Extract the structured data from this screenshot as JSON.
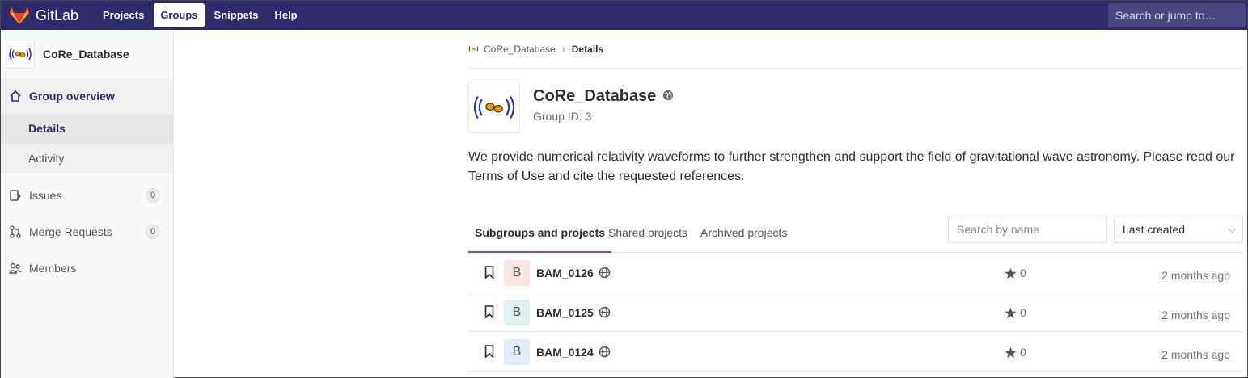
{
  "navbar": {
    "brand": "GitLab",
    "items": [
      {
        "label": "Projects",
        "active": false
      },
      {
        "label": "Groups",
        "active": true
      },
      {
        "label": "Snippets",
        "active": false
      },
      {
        "label": "Help",
        "active": false
      }
    ],
    "search_placeholder": "Search or jump to…"
  },
  "sidebar": {
    "context_title": "CoRe_Database",
    "overview_label": "Group overview",
    "sub_items": [
      "Details",
      "Activity"
    ],
    "issues_label": "Issues",
    "issues_count": "0",
    "mr_label": "Merge Requests",
    "mr_count": "0",
    "members_label": "Members"
  },
  "breadcrumb": {
    "group": "CoRe_Database",
    "current": "Details"
  },
  "group": {
    "name": "CoRe_Database",
    "id_text": "Group ID: 3",
    "description": "We provide numerical relativity waveforms to further strengthen and support the field of gravitational wave astronomy. Please read our Terms of Use and cite the requested references."
  },
  "tabs": {
    "subgroups": "Subgroups and projects",
    "shared": "Shared projects",
    "archived": "Archived projects"
  },
  "filter": {
    "placeholder": "Search by name",
    "sort": "Last created"
  },
  "projects": [
    {
      "initial": "B",
      "name": "BAM_0126",
      "stars": "0",
      "updated": "2 months ago",
      "avatar_bg": "#fbe5e1"
    },
    {
      "initial": "B",
      "name": "BAM_0125",
      "stars": "0",
      "updated": "2 months ago",
      "avatar_bg": "#e0f2f0"
    },
    {
      "initial": "B",
      "name": "BAM_0124",
      "stars": "0",
      "updated": "2 months ago",
      "avatar_bg": "#e1ecfb"
    }
  ],
  "colors": {
    "navbar": "#2f2a6b",
    "active_tab_border": "#6b4fbb"
  }
}
